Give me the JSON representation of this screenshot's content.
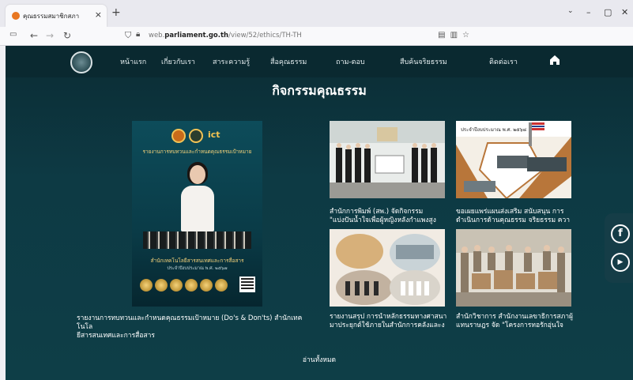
{
  "browser": {
    "tab_title": "คุณธรรมสมาชิกสภา",
    "url_prefix": "web.",
    "url_domain": "parliament.go.th",
    "url_path": "/view/52/ethics/TH-TH",
    "new_tab": "+",
    "close_tab": "×",
    "minimize": "–",
    "maximize": "▢",
    "close_window": "✕"
  },
  "site": {
    "nav": [
      "หน้าแรก",
      "เกี่ยวกับเรา",
      "สาระความรู้",
      "สื่อคุณธรรม",
      "ถาม-ตอบ",
      "สืบค้นจริยธรรม",
      "ติดต่อเรา"
    ],
    "page_title": "กิจกรรมคุณธรรม",
    "poster": {
      "ict_label": "ict",
      "heading": "รายงานการทบทวนและกำหนดคุณธรรมเป้าหมาย",
      "sub": "สำนักเทคโนโลยีสารสนเทศและการสื่อสาร",
      "sub2": "ประจำปีงบประมาณ พ.ศ. ๒๕๖๗"
    },
    "featured_caption_1": "รายงานการทบทวนและกำหนดคุณธรรมเป้าหมาย (Do's & Don'ts) สำนักเทคโนโล",
    "featured_caption_2": "ยีสารสนเทศและการสื่อสาร",
    "cards": [
      {
        "line1": "สำนักการพิมพ์ (สพ.) จัดกิจกรรม",
        "line2": "\"แบ่งปันน้ำใจเพื่อผู้หญิงหลังกำแพงสูง"
      },
      {
        "line1": "ขอเผยแพร่แผนส่งเสริม สนับสนุน การ",
        "line2": "ดำเนินการด้านคุณธรรม จริยธรรม ควา"
      },
      {
        "line1": "รายงานสรุป การนำหลักธรรมทางศาสนา",
        "line2": "มาประยุกต์ใช้ภายในสำนักการคลังและง"
      },
      {
        "line1": "สำนักวิชาการ สำนักงานเลขาธิการสภาผู้",
        "line2": "แทนราษฎร จัด \"โครงการทอรักอุ่นใจ"
      }
    ],
    "card2_banner": "ประจำปีงบประมาณ พ.ศ. ๒๕๖๘",
    "read_all": "อ่านทั้งหมด",
    "social": {
      "facebook": "f",
      "youtube": "▶"
    }
  },
  "colors": {
    "site_bg": "#0d3a44",
    "nav_bg": "#0a2930",
    "text": "#ffffff"
  }
}
